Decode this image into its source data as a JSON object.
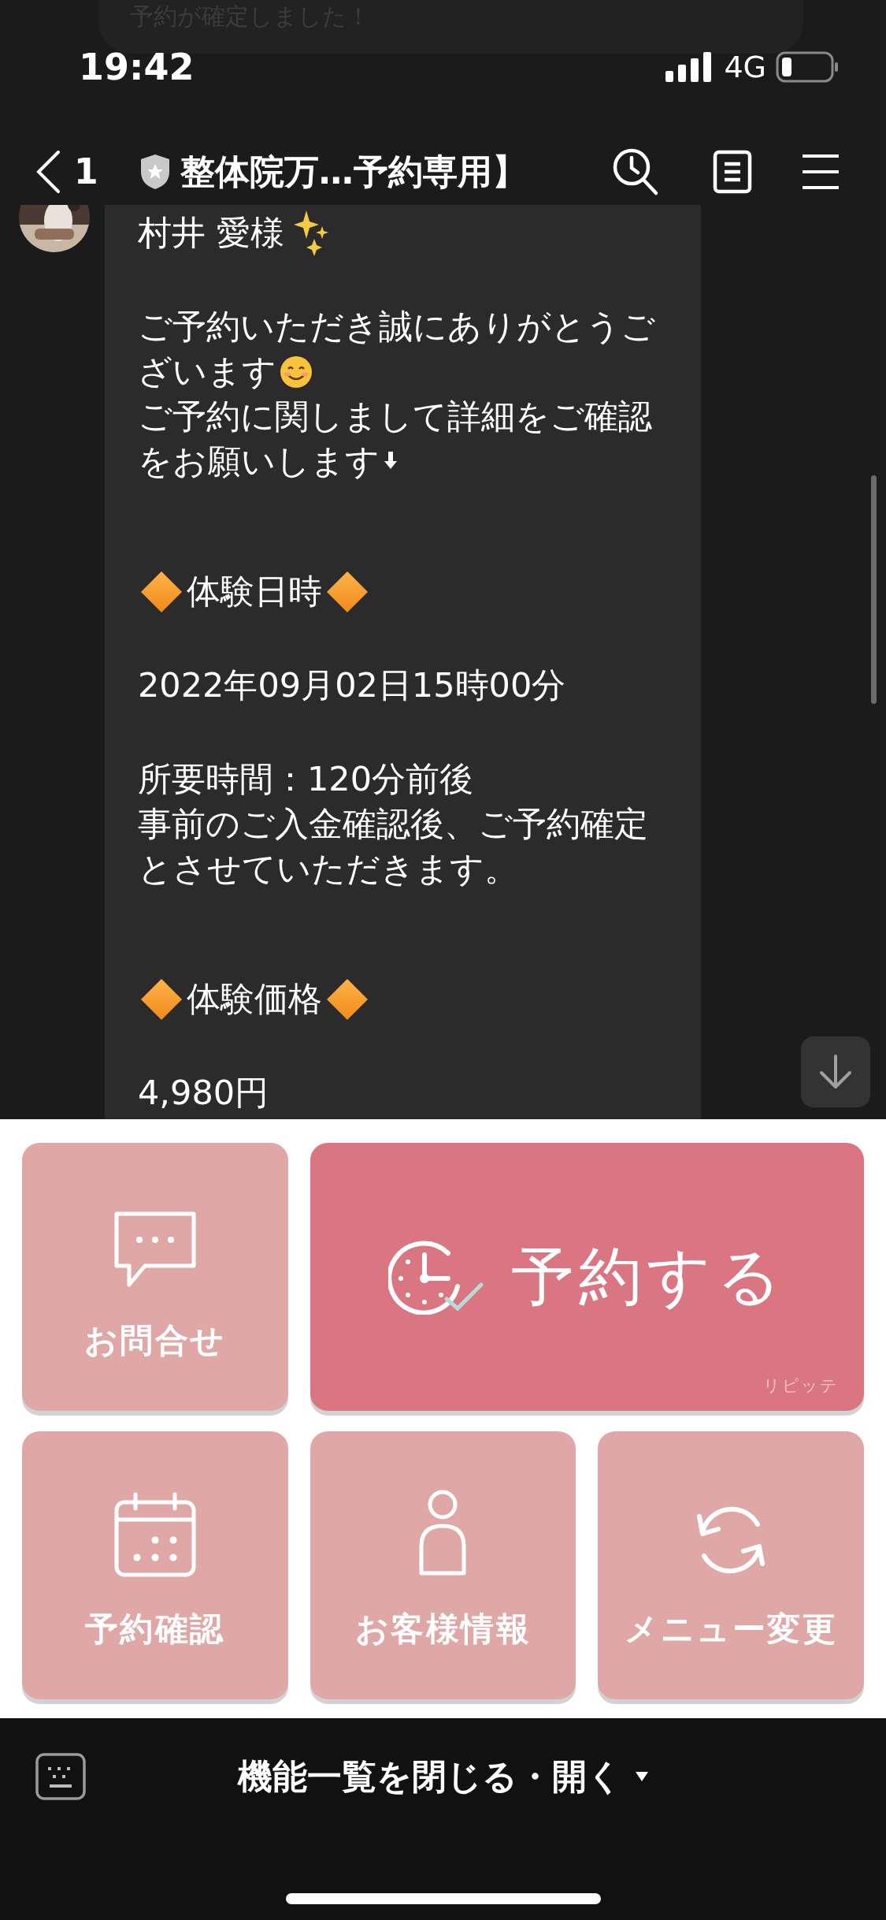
{
  "notification": {
    "text": "予約が確定しました！"
  },
  "status_bar": {
    "time": "19:42",
    "network": "4G"
  },
  "header": {
    "back_count": "1",
    "title": "整体院万…予約専用】"
  },
  "message": {
    "blocks": [
      {
        "kind": "greeting",
        "lines": [
          {
            "text": "村井 愛様"
          }
        ]
      },
      {
        "kind": "text",
        "lines": [
          {
            "text": "ご予約いただき誠にありがとうご"
          },
          {
            "text": "ざいます"
          },
          {
            "text": "ご予約に関しまして詳細をご確認"
          },
          {
            "text": "をお願いします"
          }
        ]
      },
      {
        "kind": "heading",
        "lines": [
          {
            "text": "体験日時"
          }
        ]
      },
      {
        "kind": "text",
        "lines": [
          {
            "text": "2022年09月02日15時00分"
          }
        ]
      },
      {
        "kind": "text",
        "lines": [
          {
            "text": "所要時間：120分前後"
          },
          {
            "text": "事前のご入金確認後、ご予約確定"
          },
          {
            "text": "とさせていただきます。"
          }
        ]
      },
      {
        "kind": "heading",
        "lines": [
          {
            "text": "体験価格"
          }
        ]
      },
      {
        "kind": "text",
        "lines": [
          {
            "text": "4,980円"
          }
        ]
      }
    ]
  },
  "rich_menu": {
    "items": [
      {
        "kind": "small",
        "label": "お問合せ"
      },
      {
        "kind": "large",
        "label": "予約する",
        "caption": "リピッテ"
      },
      {
        "kind": "small",
        "label": "予約確認"
      },
      {
        "kind": "small",
        "label": "お客様情報"
      },
      {
        "kind": "small",
        "label": "メニュー変更"
      }
    ]
  },
  "footer": {
    "label": "機能一覧を閉じる・開く"
  }
}
